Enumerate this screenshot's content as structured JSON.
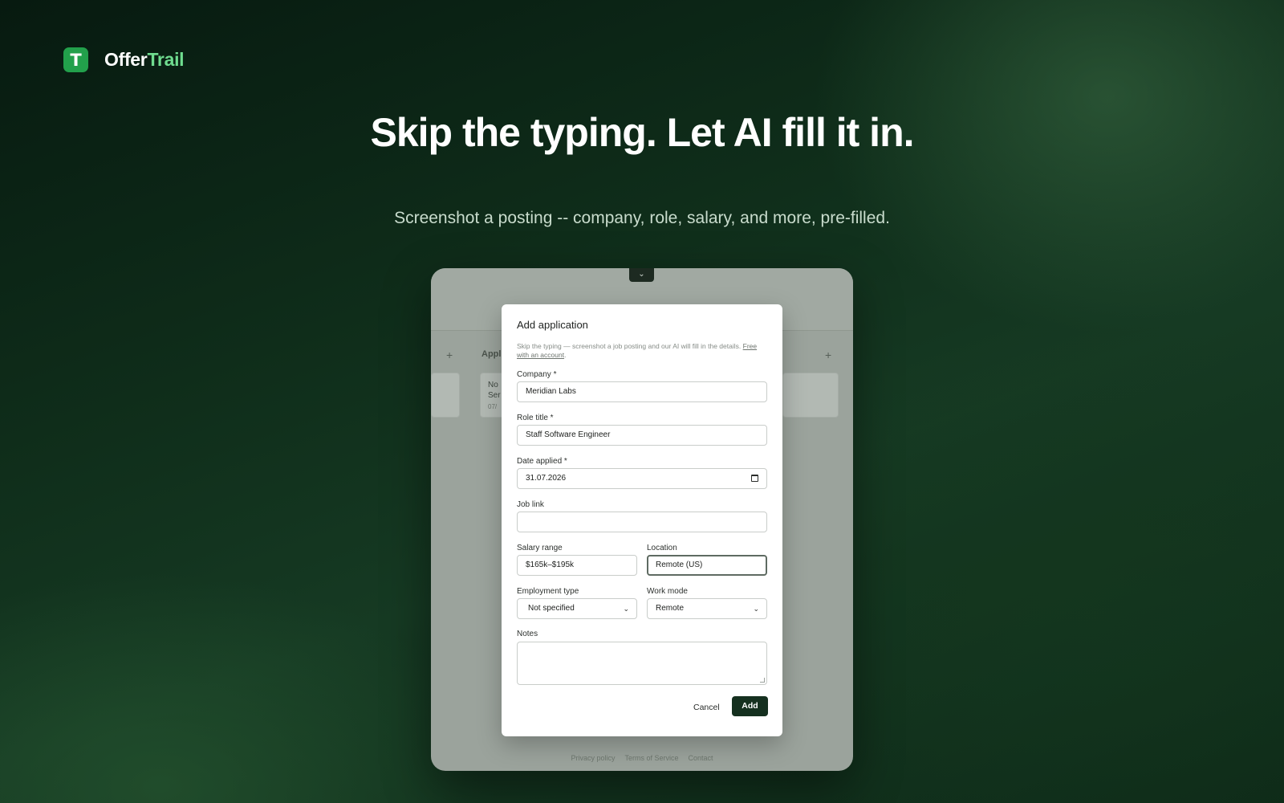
{
  "brand": {
    "logo_letter": "T",
    "name_part1": "Offer",
    "name_part2": "Trail",
    "accent": "#6fdc8f",
    "logo_bg": "#22a04b"
  },
  "hero": {
    "headline": "Skip the typing. Let AI fill it in.",
    "subline": "Screenshot a posting -- company, role, salary, and more, pre-filled."
  },
  "background_app": {
    "column_label": "Appl",
    "plus_symbol": "+",
    "card_line1": "No",
    "card_line2": "Ser",
    "card_line3": "07/",
    "footer_links": [
      "Privacy policy",
      "Terms of Service",
      "Contact"
    ]
  },
  "modal": {
    "title": "Add application",
    "description": "Skip the typing — screenshot a job posting and our AI will fill in the details.",
    "description_link": "Free with an account",
    "fields": {
      "company": {
        "label": "Company *",
        "value": "Meridian Labs"
      },
      "role_title": {
        "label": "Role title *",
        "value": "Staff Software Engineer"
      },
      "date_applied": {
        "label": "Date applied *",
        "value": "31.07.2026"
      },
      "job_link": {
        "label": "Job link",
        "value": ""
      },
      "salary_range": {
        "label": "Salary range",
        "value": "$165k–$195k"
      },
      "location": {
        "label": "Location",
        "value": "Remote (US)"
      },
      "employment_type": {
        "label": "Employment type",
        "selected": "Not specified"
      },
      "work_mode": {
        "label": "Work mode",
        "selected": "Remote"
      },
      "notes": {
        "label": "Notes",
        "value": ""
      }
    },
    "buttons": {
      "cancel": "Cancel",
      "add": "Add"
    }
  },
  "icons": {
    "calendar": "calendar-icon",
    "select_chevron": "chevron-down-icon",
    "collapse": "chevron-down-icon"
  }
}
